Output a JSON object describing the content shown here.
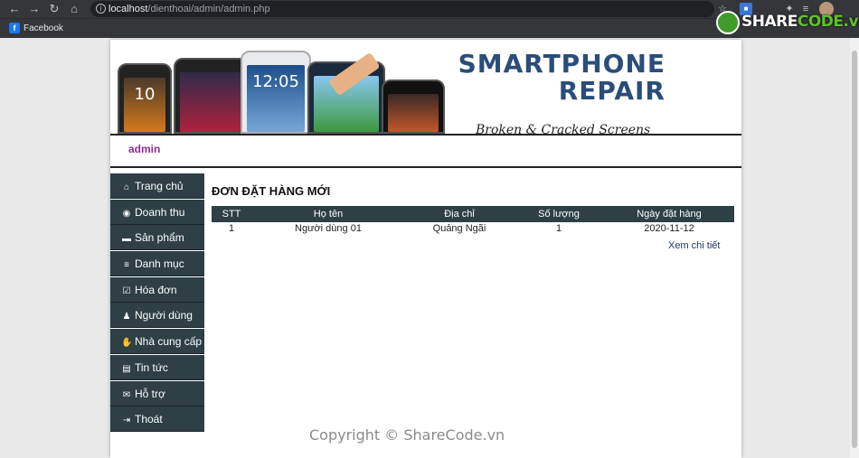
{
  "browser": {
    "url_host": "localhost",
    "url_path": "/dienthoai/admin/admin.php",
    "bookmark": "Facebook"
  },
  "watermark": {
    "brand_prefix": "SHARE",
    "brand_suffix": "CODE.vn",
    "copyright": "Copyright © ShareCode.vn",
    "banner_overlay": "ShareCode.vn"
  },
  "banner": {
    "title_line1": "SMARTPHONE",
    "title_line2": "REPAIR",
    "subtitle": "Broken & Cracked Screens",
    "clock": "12:05",
    "clock2": "10"
  },
  "user": {
    "name": "admin"
  },
  "sidebar": {
    "items": [
      {
        "label": "Trang chủ",
        "icon": "home-icon",
        "glyph": "⌂"
      },
      {
        "label": "Doanh thu",
        "icon": "money-icon",
        "glyph": "◉"
      },
      {
        "label": "Sản phẩm",
        "icon": "box-icon",
        "glyph": "▬"
      },
      {
        "label": "Danh mục",
        "icon": "list-icon",
        "glyph": "≡"
      },
      {
        "label": "Hóa đơn",
        "icon": "invoice-icon",
        "glyph": "☑"
      },
      {
        "label": "Người dùng",
        "icon": "user-icon",
        "glyph": "♟"
      },
      {
        "label": "Nhà cung cấp",
        "icon": "handshake-icon",
        "glyph": "✋"
      },
      {
        "label": "Tin tức",
        "icon": "news-icon",
        "glyph": "▤"
      },
      {
        "label": "Hỗ trợ",
        "icon": "mail-icon",
        "glyph": "✉"
      },
      {
        "label": "Thoát",
        "icon": "logout-icon",
        "glyph": "⇥"
      }
    ]
  },
  "orders": {
    "title": "ĐƠN ĐẶT HÀNG MỚI",
    "columns": [
      "STT",
      "Họ tên",
      "Địa chỉ",
      "Số lượng",
      "Ngày đặt hàng"
    ],
    "rows": [
      {
        "stt": "1",
        "name": "Người dùng 01",
        "address": "Quảng Ngãi",
        "qty": "1",
        "date": "2020-11-12"
      }
    ],
    "detail_link": "Xem chi tiết"
  }
}
